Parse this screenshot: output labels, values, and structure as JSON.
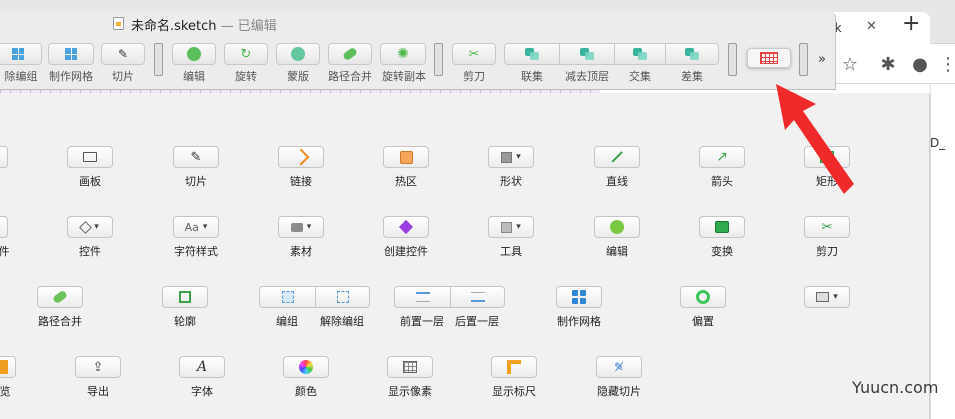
{
  "browser": {
    "tab_title_fragment": "ck",
    "tab_close": "✕",
    "new_tab": "+",
    "toolbar_icons": [
      "star-icon",
      "extensions-puzzle-icon",
      "profile-avatar-icon",
      "more-menu-icon"
    ],
    "side_text_fragment": "D_"
  },
  "window": {
    "document_name": "未命名.sketch",
    "separator": "—",
    "status": "已编辑"
  },
  "toolbar": {
    "items": [
      {
        "label": "除编组",
        "icon": "ungroup-icon"
      },
      {
        "label": "制作网格",
        "icon": "grid-icon"
      },
      {
        "label": "切片",
        "icon": "slice-icon"
      },
      {
        "label": "编辑",
        "icon": "edit-icon"
      },
      {
        "label": "旋转",
        "icon": "rotate-icon"
      },
      {
        "label": "蒙版",
        "icon": "mask-icon"
      },
      {
        "label": "路径合并",
        "icon": "path-combine-icon"
      },
      {
        "label": "旋转副本",
        "icon": "rotate-copies-icon"
      },
      {
        "label": "剪刀",
        "icon": "scissors-icon"
      },
      {
        "label": "联集",
        "icon": "union-icon"
      },
      {
        "label": "减去顶层",
        "icon": "subtract-icon"
      },
      {
        "label": "交集",
        "icon": "intersect-icon"
      },
      {
        "label": "差集",
        "icon": "difference-icon"
      }
    ],
    "dragged_item_icon": "pixel-grid-icon",
    "overflow": "»"
  },
  "panel": {
    "rows": [
      [
        {
          "label": "画板",
          "icon": "artboard-icon"
        },
        {
          "label": "切片",
          "icon": "slice-icon"
        },
        {
          "label": "链接",
          "icon": "link-icon"
        },
        {
          "label": "热区",
          "icon": "hotspot-icon"
        },
        {
          "label": "形状",
          "icon": "shape-icon",
          "dropdown": true
        },
        {
          "label": "直线",
          "icon": "line-icon"
        },
        {
          "label": "箭头",
          "icon": "arrow-icon"
        },
        {
          "label": "矩形",
          "icon": "rectangle-icon"
        }
      ],
      [
        {
          "label": "控件",
          "icon": "symbol-icon",
          "dropdown": true
        },
        {
          "label": "字符样式",
          "icon": "text-style-icon",
          "dropdown": true
        },
        {
          "label": "素材",
          "icon": "library-icon",
          "dropdown": true
        },
        {
          "label": "创建控件",
          "icon": "create-symbol-icon"
        },
        {
          "label": "工具",
          "icon": "tools-icon",
          "dropdown": true
        },
        {
          "label": "编辑",
          "icon": "edit-icon"
        },
        {
          "label": "变换",
          "icon": "transform-icon"
        },
        {
          "label": "剪刀",
          "icon": "scissors-icon"
        }
      ],
      [
        {
          "label": "路径合并",
          "icon": "path-combine-icon"
        },
        {
          "label": "轮廓",
          "icon": "outline-icon"
        },
        {
          "label": "编组",
          "icon": "group-icon"
        },
        {
          "label": "解除编组",
          "icon": "ungroup-icon"
        },
        {
          "label": "前置一层",
          "icon": "bring-forward-icon"
        },
        {
          "label": "后置一层",
          "icon": "send-backward-icon"
        },
        {
          "label": "制作网格",
          "icon": "make-grid-icon"
        },
        {
          "label": "偏置",
          "icon": "offset-icon"
        },
        {
          "label": "",
          "icon": "arrange-icon",
          "dropdown": true
        }
      ],
      [
        {
          "label": "览",
          "icon": "preview-icon"
        },
        {
          "label": "导出",
          "icon": "export-icon"
        },
        {
          "label": "字体",
          "icon": "font-icon"
        },
        {
          "label": "颜色",
          "icon": "color-icon"
        },
        {
          "label": "显示像素",
          "icon": "show-pixels-icon"
        },
        {
          "label": "显示标尺",
          "icon": "show-rulers-icon"
        },
        {
          "label": "隐藏切片",
          "icon": "hide-slices-icon"
        }
      ]
    ],
    "row1_left_fragment": "件"
  },
  "annotation": {
    "color": "#ee2a2a",
    "icon": "red-pointer-arrow-icon"
  },
  "watermark": "Yuucn.com"
}
